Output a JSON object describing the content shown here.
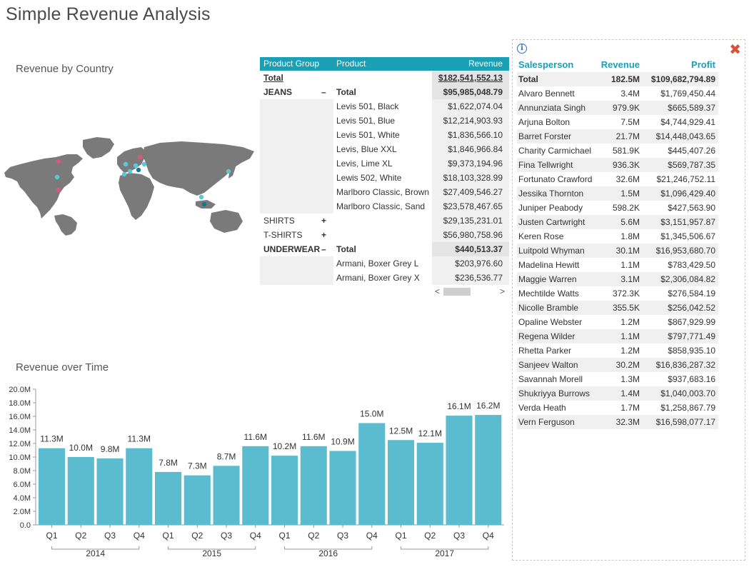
{
  "page": {
    "title": "Simple Revenue Analysis",
    "map_title": "Revenue by Country",
    "time_title": "Revenue over Time"
  },
  "colors": {
    "accent": "#1a9fb5",
    "bar": "#5bbccf",
    "map_land": "#7a7a7a",
    "dot_red": "#d9577a",
    "dot_cyan": "#5bc8d9",
    "dot_teal": "#0e7a8a",
    "close": "#d9533a"
  },
  "pivot": {
    "headers": [
      "Product Group",
      "Product",
      "Revenue"
    ],
    "rows": [
      {
        "group": "Total",
        "toggle": "",
        "product": "",
        "revenue": "$182,541,552.13",
        "style": "grand"
      },
      {
        "group": "JEANS",
        "toggle": "–",
        "product": "Total",
        "revenue": "$95,985,048.79",
        "style": "subtotal"
      },
      {
        "group": "",
        "toggle": "",
        "product": "Levis 501, Black",
        "revenue": "$1,622,074.04",
        "style": "item"
      },
      {
        "group": "",
        "toggle": "",
        "product": "Levis 501, Blue",
        "revenue": "$12,214,903.93",
        "style": "item"
      },
      {
        "group": "",
        "toggle": "",
        "product": "Levis 501, White",
        "revenue": "$1,836,566.10",
        "style": "item"
      },
      {
        "group": "",
        "toggle": "",
        "product": "Levis, Blue XXL",
        "revenue": "$1,846,966.84",
        "style": "item"
      },
      {
        "group": "",
        "toggle": "",
        "product": "Levis, Lime XL",
        "revenue": "$9,373,194.96",
        "style": "item"
      },
      {
        "group": "",
        "toggle": "",
        "product": "Lewis 502, White",
        "revenue": "$18,103,328.99",
        "style": "item"
      },
      {
        "group": "",
        "toggle": "",
        "product": "Marlboro Classic, Brown",
        "revenue": "$27,409,546.27",
        "style": "item"
      },
      {
        "group": "",
        "toggle": "",
        "product": "Marlboro Classic, Sand",
        "revenue": "$23,578,467.65",
        "style": "item"
      },
      {
        "group": "SHIRTS",
        "toggle": "+",
        "product": "",
        "revenue": "$29,135,231.01",
        "style": "collapsed"
      },
      {
        "group": "T-SHIRTS",
        "toggle": "+",
        "product": "",
        "revenue": "$56,980,758.96",
        "style": "collapsed"
      },
      {
        "group": "UNDERWEAR",
        "toggle": "–",
        "product": "Total",
        "revenue": "$440,513.37",
        "style": "subtotal"
      },
      {
        "group": "",
        "toggle": "",
        "product": "Armani, Boxer Grey L",
        "revenue": "$203,976.60",
        "style": "item"
      },
      {
        "group": "",
        "toggle": "",
        "product": "Armani, Boxer Grey X",
        "revenue": "$236,536.77",
        "style": "item"
      }
    ],
    "scroll_left": "<",
    "scroll_right": ">"
  },
  "sales": {
    "headers": [
      "Salesperson",
      "Revenue",
      "Profit"
    ],
    "total": {
      "name": "Total",
      "revenue": "182.5M",
      "profit": "$109,682,794.89"
    },
    "rows": [
      {
        "name": "Alvaro Bennett",
        "revenue": "3.4M",
        "profit": "$1,769,450.44"
      },
      {
        "name": "Annunziata Singh",
        "revenue": "979.9K",
        "profit": "$665,589.37"
      },
      {
        "name": "Arjuna Bolton",
        "revenue": "7.5M",
        "profit": "$4,744,929.41"
      },
      {
        "name": "Barret Forster",
        "revenue": "21.7M",
        "profit": "$14,448,043.65"
      },
      {
        "name": "Charity Carmichael",
        "revenue": "581.9K",
        "profit": "$445,407.26"
      },
      {
        "name": "Fina Tellwright",
        "revenue": "936.3K",
        "profit": "$569,787.35"
      },
      {
        "name": "Fortunato Crawford",
        "revenue": "32.6M",
        "profit": "$21,246,752.11"
      },
      {
        "name": "Jessika Thornton",
        "revenue": "1.5M",
        "profit": "$1,096,429.40"
      },
      {
        "name": "Juniper Peabody",
        "revenue": "598.2K",
        "profit": "$427,563.90"
      },
      {
        "name": "Justen Cartwright",
        "revenue": "5.6M",
        "profit": "$3,151,957.87"
      },
      {
        "name": "Keren Rose",
        "revenue": "1.8M",
        "profit": "$1,345,506.67"
      },
      {
        "name": "Luitpold Whyman",
        "revenue": "30.1M",
        "profit": "$16,953,680.70"
      },
      {
        "name": "Madelina Hewitt",
        "revenue": "1.1M",
        "profit": "$783,429.50"
      },
      {
        "name": "Maggie Warren",
        "revenue": "3.1M",
        "profit": "$2,306,084.82"
      },
      {
        "name": "Mechtilde Watts",
        "revenue": "372.3K",
        "profit": "$276,584.19"
      },
      {
        "name": "Nicolle Bramble",
        "revenue": "355.5K",
        "profit": "$256,042.52"
      },
      {
        "name": "Opaline Webster",
        "revenue": "1.2M",
        "profit": "$867,929.99"
      },
      {
        "name": "Regena Wilder",
        "revenue": "1.1M",
        "profit": "$797,771.49"
      },
      {
        "name": "Rhetta Parker",
        "revenue": "1.2M",
        "profit": "$858,935.10"
      },
      {
        "name": "Sanjeev Walton",
        "revenue": "30.2M",
        "profit": "$16,836,287.32"
      },
      {
        "name": "Savannah Morell",
        "revenue": "1.3M",
        "profit": "$937,683.16"
      },
      {
        "name": "Shukriyya Burrows",
        "revenue": "1.4M",
        "profit": "$1,040,003.70"
      },
      {
        "name": "Verda Heath",
        "revenue": "1.7M",
        "profit": "$1,258,867.79"
      },
      {
        "name": "Vern Ferguson",
        "revenue": "32.3M",
        "profit": "$16,598,077.17"
      }
    ]
  },
  "chart_data": {
    "type": "bar",
    "categories": [
      "Q1",
      "Q2",
      "Q3",
      "Q4",
      "Q1",
      "Q2",
      "Q3",
      "Q4",
      "Q1",
      "Q2",
      "Q3",
      "Q4",
      "Q1",
      "Q2",
      "Q3",
      "Q4"
    ],
    "groups": [
      {
        "label": "2014",
        "start": 0,
        "end": 3
      },
      {
        "label": "2015",
        "start": 4,
        "end": 7
      },
      {
        "label": "2016",
        "start": 8,
        "end": 11
      },
      {
        "label": "2017",
        "start": 12,
        "end": 15
      }
    ],
    "values": [
      11.3,
      10.0,
      9.8,
      11.3,
      7.8,
      7.3,
      8.7,
      11.6,
      10.2,
      11.6,
      10.9,
      15.0,
      12.5,
      12.1,
      16.1,
      16.2
    ],
    "data_labels": [
      "11.3M",
      "10.0M",
      "9.8M",
      "11.3M",
      "7.8M",
      "7.3M",
      "8.7M",
      "11.6M",
      "10.2M",
      "11.6M",
      "10.9M",
      "15.0M",
      "12.5M",
      "12.1M",
      "16.1M",
      "16.2M"
    ],
    "yticks": [
      0,
      2,
      4,
      6,
      8,
      10,
      12,
      14,
      16,
      18,
      20
    ],
    "ytick_labels": [
      "0.0",
      "2.0M",
      "4.0M",
      "6.0M",
      "8.0M",
      "10.0M",
      "12.0M",
      "14.0M",
      "16.0M",
      "18.0M",
      "20.0M"
    ],
    "ylim": [
      0,
      20
    ],
    "grid": false,
    "legend": "none"
  }
}
